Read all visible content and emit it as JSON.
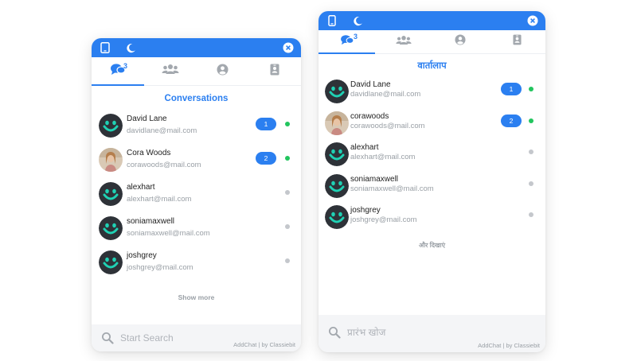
{
  "widgets": [
    {
      "language": "English",
      "title": "Conversations",
      "unread_badge": "3",
      "contacts": [
        {
          "name": "David Lane",
          "email": "davidlane@mail.com",
          "unread": "1",
          "online": true,
          "photo": false
        },
        {
          "name": "Cora Woods",
          "email": "corawoods@mail.com",
          "unread": "2",
          "online": true,
          "photo": true
        },
        {
          "name": "alexhart",
          "email": "alexhart@mail.com",
          "unread": "",
          "online": false,
          "photo": false
        },
        {
          "name": "soniamaxwell",
          "email": "soniamaxwell@mail.com",
          "unread": "",
          "online": false,
          "photo": false
        },
        {
          "name": "joshgrey",
          "email": "joshgrey@mail.com",
          "unread": "",
          "online": false,
          "photo": false
        }
      ],
      "show_more": "Show more",
      "search_placeholder": "Start Search",
      "credit": "AddChat | by Classiebit"
    },
    {
      "language": "Hindi",
      "title": "वार्तालाप",
      "unread_badge": "3",
      "contacts": [
        {
          "name": "David Lane",
          "email": "davidlane@mail.com",
          "unread": "1",
          "online": true,
          "photo": false
        },
        {
          "name": "corawoods",
          "email": "corawoods@mail.com",
          "unread": "2",
          "online": true,
          "photo": true
        },
        {
          "name": "alexhart",
          "email": "alexhart@mail.com",
          "unread": "",
          "online": false,
          "photo": false
        },
        {
          "name": "soniamaxwell",
          "email": "soniamaxwell@mail.com",
          "unread": "",
          "online": false,
          "photo": false
        },
        {
          "name": "joshgrey",
          "email": "joshgrey@mail.com",
          "unread": "",
          "online": false,
          "photo": false
        }
      ],
      "show_more": "और दिखाएं",
      "search_placeholder": "प्रारंभ खोज",
      "credit": "AddChat | by Classiebit"
    }
  ],
  "icons": {
    "topbar": [
      "tablet-icon",
      "moon-icon",
      "close-icon"
    ],
    "tabs": [
      "conversations-icon",
      "users-icon",
      "profile-icon",
      "contact-card-icon"
    ],
    "search": "search-icon"
  },
  "colors": {
    "accent": "#2b7ff0",
    "online": "#22c55e",
    "offline": "#c4c7cc",
    "avatar_bg": "#2e3238",
    "avatar_face": "#1fd1b4"
  }
}
